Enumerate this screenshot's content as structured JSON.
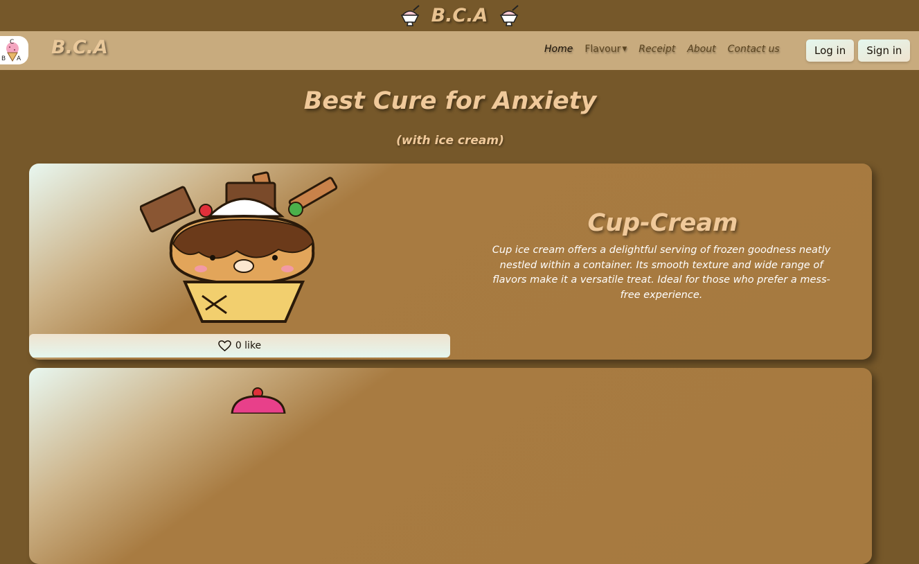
{
  "topbar": {
    "title": "B.C.A"
  },
  "navbar": {
    "brand": "B.C.A",
    "logo_text": {
      "top": "C",
      "left": "B",
      "right": "A"
    },
    "links": [
      {
        "label": "Home",
        "active": true
      },
      {
        "label": "Flavour",
        "dropdown": true
      },
      {
        "label": "Receipt"
      },
      {
        "label": "About"
      },
      {
        "label": "Contact us"
      }
    ],
    "login_label": "Log in",
    "signin_label": "Sign in"
  },
  "hero": {
    "title": "Best Cure for Anxiety",
    "subtitle": "(with ice cream)"
  },
  "cards": [
    {
      "title": "Cup-Cream",
      "description": "Cup ice cream offers a delightful serving of frozen goodness neatly nestled within a container. Its smooth texture and wide range of flavors make it a versatile treat. Ideal for those who prefer a mess-free experience.",
      "like_label": "0 like",
      "image_icon": "cup-ice-cream-icon"
    },
    {
      "image_icon": "cupcake-icon"
    }
  ],
  "colors": {
    "background": "#76582a",
    "navbar": "#c8ab7e",
    "accent_text": "#f0c99a",
    "card": "#a67a40"
  }
}
